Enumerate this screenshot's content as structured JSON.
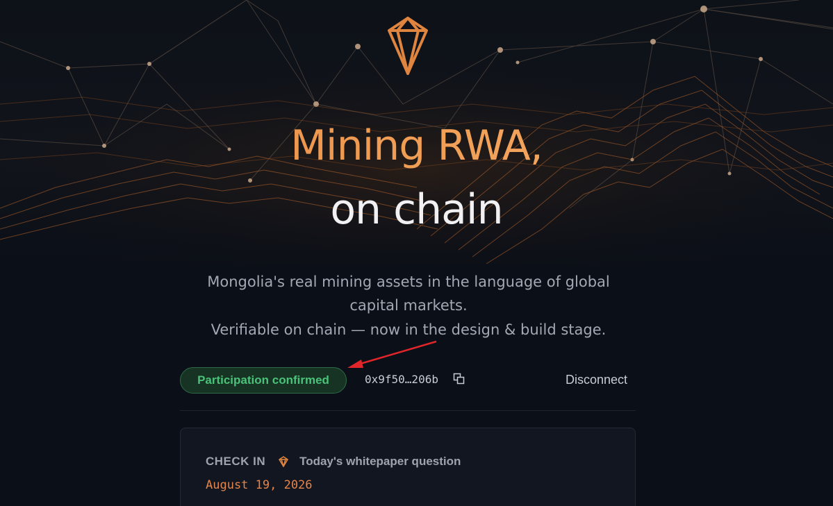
{
  "hero": {
    "title_line1": "Mining RWA,",
    "title_line2": "on chain",
    "logo_icon": "diamond-gem-icon",
    "accent_color": "#e8873d"
  },
  "subtitle": {
    "line1": "Mongolia's real mining assets in the language of global",
    "line2": "capital markets.",
    "line3": "Verifiable on chain — now in the design & build stage."
  },
  "status": {
    "badge_label": "Participation confirmed",
    "badge_color": "#4bc27a",
    "wallet_address": "0x9f50…206b",
    "copy_icon": "copy-icon",
    "disconnect_label": "Disconnect"
  },
  "checkin_card": {
    "label": "CHECK IN",
    "gem_icon": "gem-icon",
    "question_label": "Today's whitepaper question",
    "date": "August 19, 2026"
  },
  "annotation": {
    "arrow_color": "#e0262b"
  }
}
